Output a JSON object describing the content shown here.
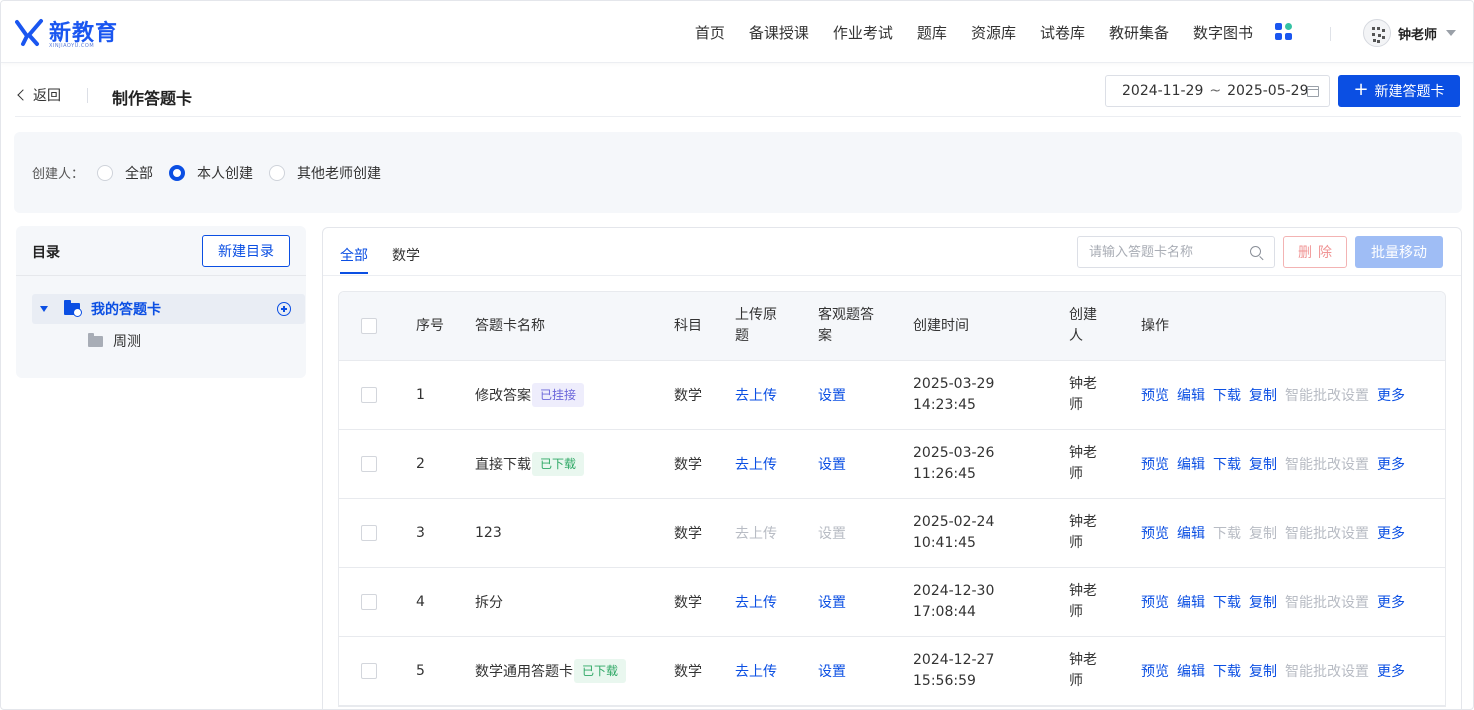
{
  "header": {
    "logo_text": "新教育",
    "logo_sub": "XINJIAOYU.COM",
    "nav": [
      "首页",
      "备课授课",
      "作业考试",
      "题库",
      "资源库",
      "试卷库",
      "教研集备",
      "数字图书"
    ],
    "user_name": "钟老师",
    "colors": {
      "brand": "#0b4fe3"
    }
  },
  "subheader": {
    "back_label": "返回",
    "title": "制作答题卡",
    "date_start": "2024-11-29",
    "date_sep": "~",
    "date_end": "2025-05-29",
    "new_card_label": "新建答题卡",
    "new_card_icon": "+"
  },
  "filter": {
    "label": "创建人：",
    "options": [
      "全部",
      "本人创建",
      "其他老师创建"
    ],
    "selected": "本人创建"
  },
  "directory": {
    "title": "目录",
    "new_dir_label": "新建目录",
    "root": "我的答题卡",
    "children": [
      "周测"
    ]
  },
  "content": {
    "tabs": [
      "全部",
      "数学"
    ],
    "active_tab": "全部",
    "search_placeholder": "请输入答题卡名称",
    "delete_label": "删除",
    "batch_move_label": "批量移动"
  },
  "table": {
    "headers": {
      "index": "序号",
      "name": "答题卡名称",
      "subject": "科目",
      "upload": [
        "上传原",
        "题"
      ],
      "objective": [
        "客观题答",
        "案"
      ],
      "created_time": "创建时间",
      "creator": [
        "创建",
        "人"
      ],
      "ops": "操作"
    },
    "rows": [
      {
        "index": "1",
        "name": "修改答案",
        "tag": "已挂接",
        "tag_type": "mounted",
        "subject": "数学",
        "upload": "去上传",
        "upload_enabled": true,
        "objective": "设置",
        "objective_enabled": true,
        "date": "2025-03-29",
        "time": "14:23:45",
        "creator": [
          "钟老",
          "师"
        ],
        "ops": {
          "preview": "预览",
          "edit": "编辑",
          "download": "下载",
          "copy": "复制",
          "smart": "智能批改设置",
          "more": "更多"
        },
        "download_enabled": true,
        "copy_enabled": true
      },
      {
        "index": "2",
        "name": "直接下载",
        "tag": "已下载",
        "tag_type": "down",
        "subject": "数学",
        "upload": "去上传",
        "upload_enabled": true,
        "objective": "设置",
        "objective_enabled": true,
        "date": "2025-03-26",
        "time": "11:26:45",
        "creator": [
          "钟老",
          "师"
        ],
        "ops": {
          "preview": "预览",
          "edit": "编辑",
          "download": "下载",
          "copy": "复制",
          "smart": "智能批改设置",
          "more": "更多"
        },
        "download_enabled": true,
        "copy_enabled": true
      },
      {
        "index": "3",
        "name": "123",
        "tag": "",
        "tag_type": "",
        "subject": "数学",
        "upload": "去上传",
        "upload_enabled": false,
        "objective": "设置",
        "objective_enabled": false,
        "date": "2025-02-24",
        "time": "10:41:45",
        "creator": [
          "钟老",
          "师"
        ],
        "ops": {
          "preview": "预览",
          "edit": "编辑",
          "download": "下载",
          "copy": "复制",
          "smart": "智能批改设置",
          "more": "更多"
        },
        "download_enabled": false,
        "copy_enabled": false
      },
      {
        "index": "4",
        "name": "拆分",
        "tag": "",
        "tag_type": "",
        "subject": "数学",
        "upload": "去上传",
        "upload_enabled": true,
        "objective": "设置",
        "objective_enabled": true,
        "date": "2024-12-30",
        "time": "17:08:44",
        "creator": [
          "钟老",
          "师"
        ],
        "ops": {
          "preview": "预览",
          "edit": "编辑",
          "download": "下载",
          "copy": "复制",
          "smart": "智能批改设置",
          "more": "更多"
        },
        "download_enabled": true,
        "copy_enabled": true
      },
      {
        "index": "5",
        "name": "数学通用答题卡",
        "tag": "已下载",
        "tag_type": "down",
        "subject": "数学",
        "upload": "去上传",
        "upload_enabled": true,
        "objective": "设置",
        "objective_enabled": true,
        "date": "2024-12-27",
        "time": "15:56:59",
        "creator": [
          "钟老",
          "师"
        ],
        "ops": {
          "preview": "预览",
          "edit": "编辑",
          "download": "下载",
          "copy": "复制",
          "smart": "智能批改设置",
          "more": "更多"
        },
        "download_enabled": true,
        "copy_enabled": true
      }
    ]
  }
}
